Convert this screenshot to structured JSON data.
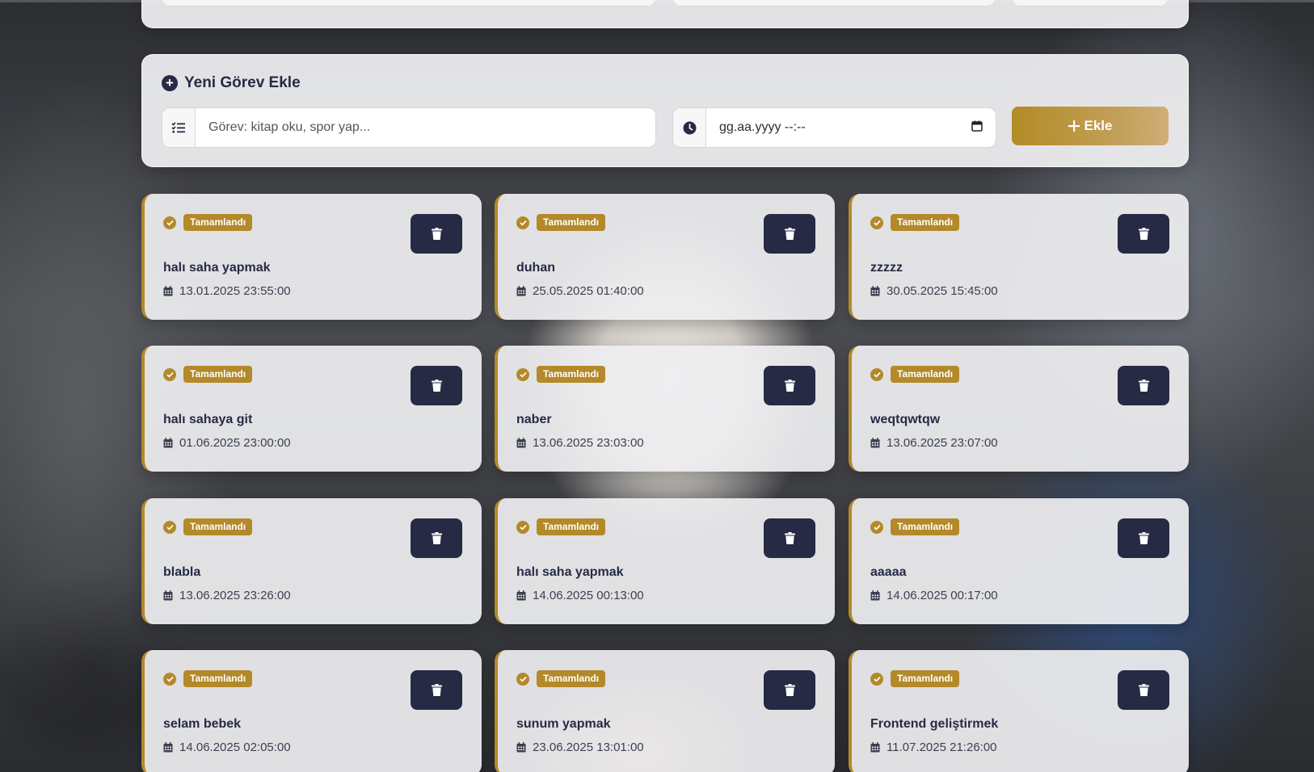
{
  "colors": {
    "accent": "#b3892a",
    "dark": "#262a44"
  },
  "add_task": {
    "title": "Yeni Görev Ekle",
    "task_placeholder": "Görev: kitap oku, spor yap...",
    "task_icon": "list-check-icon",
    "date_placeholder": "gg.aa.yyyy --:--",
    "date_icon": "clock-icon",
    "calendar_icon": "calendar-icon",
    "button_label": "Ekle"
  },
  "tasks": [
    {
      "status": "Tamamlandı",
      "title": "halı saha yapmak",
      "date": "13.01.2025 23:55:00"
    },
    {
      "status": "Tamamlandı",
      "title": "duhan",
      "date": "25.05.2025 01:40:00"
    },
    {
      "status": "Tamamlandı",
      "title": "zzzzz",
      "date": "30.05.2025 15:45:00"
    },
    {
      "status": "Tamamlandı",
      "title": "halı sahaya git",
      "date": "01.06.2025 23:00:00"
    },
    {
      "status": "Tamamlandı",
      "title": "naber",
      "date": "13.06.2025 23:03:00"
    },
    {
      "status": "Tamamlandı",
      "title": "weqtqwtqw",
      "date": "13.06.2025 23:07:00"
    },
    {
      "status": "Tamamlandı",
      "title": "blabla",
      "date": "13.06.2025 23:26:00"
    },
    {
      "status": "Tamamlandı",
      "title": "halı saha yapmak",
      "date": "14.06.2025 00:13:00"
    },
    {
      "status": "Tamamlandı",
      "title": "aaaaa",
      "date": "14.06.2025 00:17:00"
    },
    {
      "status": "Tamamlandı",
      "title": "selam bebek",
      "date": "14.06.2025 02:05:00"
    },
    {
      "status": "Tamamlandı",
      "title": "sunum yapmak",
      "date": "23.06.2025 13:01:00"
    },
    {
      "status": "Tamamlandı",
      "title": "Frontend geliştirmek",
      "date": "11.07.2025 21:26:00"
    }
  ]
}
